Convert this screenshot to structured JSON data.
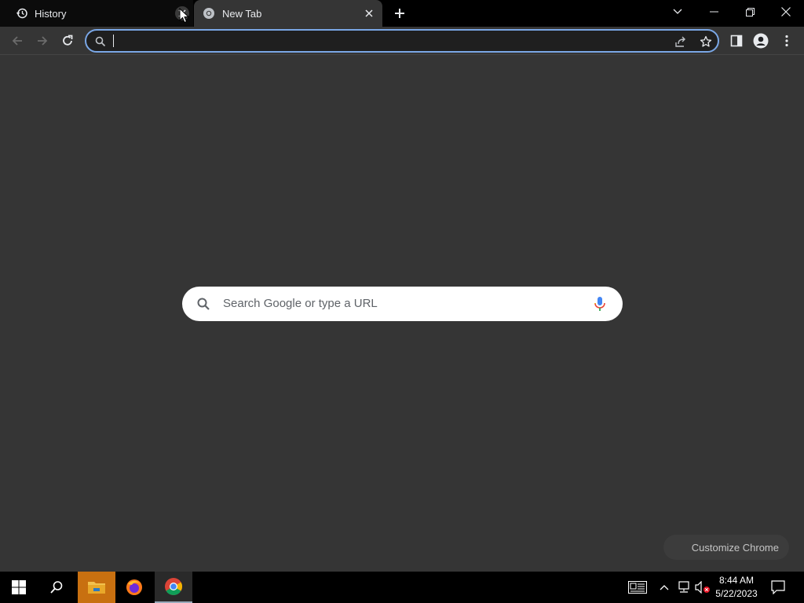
{
  "colors": {
    "accent": "#7aa7e6",
    "page_bg": "#353535",
    "tabstrip_bg": "#000000",
    "explorer_highlight": "#c87010"
  },
  "tabs": [
    {
      "title": "History",
      "icon": "history-icon",
      "active": false
    },
    {
      "title": "New Tab",
      "icon": "chrome-icon",
      "active": true
    }
  ],
  "window_controls": {
    "icons": [
      "tab-search-icon",
      "minimize-icon",
      "restore-icon",
      "close-icon"
    ]
  },
  "toolbar": {
    "icons": [
      "back-icon",
      "forward-icon",
      "reload-icon",
      "share-icon",
      "star-icon",
      "side-panel-icon",
      "profile-icon",
      "menu-icon"
    ]
  },
  "omnibox": {
    "value": "",
    "placeholder": ""
  },
  "ntp": {
    "search_placeholder": "Search Google or type a URL",
    "customize_label": "Customize Chrome"
  },
  "taskbar": {
    "pinned": [
      "windows-start-icon",
      "search-icon",
      "file-explorer-icon",
      "firefox-icon",
      "chrome-icon"
    ],
    "tray_icons": [
      "news-widget-icon",
      "show-hidden-icons-icon",
      "network-icon",
      "volume-muted-icon"
    ],
    "time": "8:44 AM",
    "date": "5/22/2023"
  }
}
